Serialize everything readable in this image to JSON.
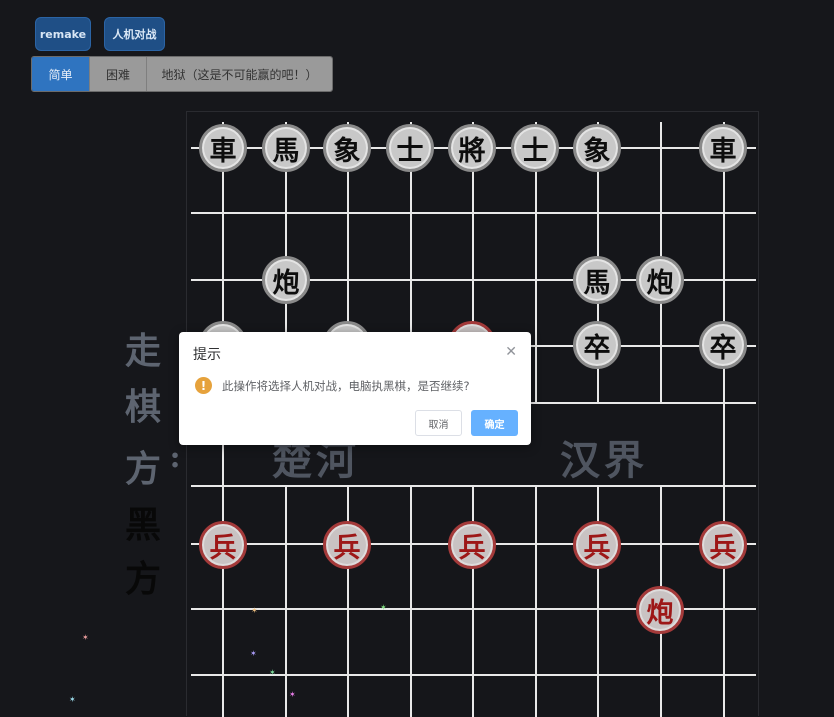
{
  "toolbar": {
    "remake_label": "remake",
    "pvc_label": "人机对战"
  },
  "difficulty": {
    "options": [
      "简单",
      "困难",
      "地狱（这是不可能赢的吧！）"
    ],
    "selected": "简单"
  },
  "side_label": {
    "prefix": [
      "走",
      "棋",
      "方",
      ":"
    ],
    "side": [
      "黑",
      "方"
    ]
  },
  "river": {
    "left": "楚河",
    "right": "汉界"
  },
  "pieces": {
    "black_rook_1": "車",
    "black_horse_1": "馬",
    "black_elephant_1": "象",
    "black_advisor_1": "士",
    "black_general": "將",
    "black_advisor_2": "士",
    "black_elephant_2": "象",
    "black_rook_2": "車",
    "black_cannon_1": "炮",
    "black_horse_2": "馬",
    "black_cannon_2": "炮",
    "black_pawn_1": "卒",
    "black_pawn_2": "卒",
    "black_pawn_3": "卒",
    "black_pawn_4": "卒",
    "black_pawn_5": "卒",
    "red_pawn_1": "兵",
    "red_pawn_2": "兵",
    "red_pawn_3": "兵",
    "red_pawn_4": "兵",
    "red_pawn_5": "兵",
    "red_cannon_1": "炮"
  },
  "dialog": {
    "title": "提示",
    "close_icon": "close-icon",
    "warning_icon": "warning-icon",
    "message": "此操作将选择人机对战，电脑执黑棋，是否继续?",
    "cancel_label": "取消",
    "confirm_label": "确定"
  },
  "colors": {
    "background": "#16171b",
    "primary": "#2f74c0",
    "red_piece": "#9d1717",
    "warning": "#e6a23c",
    "confirm": "#66b1ff"
  }
}
